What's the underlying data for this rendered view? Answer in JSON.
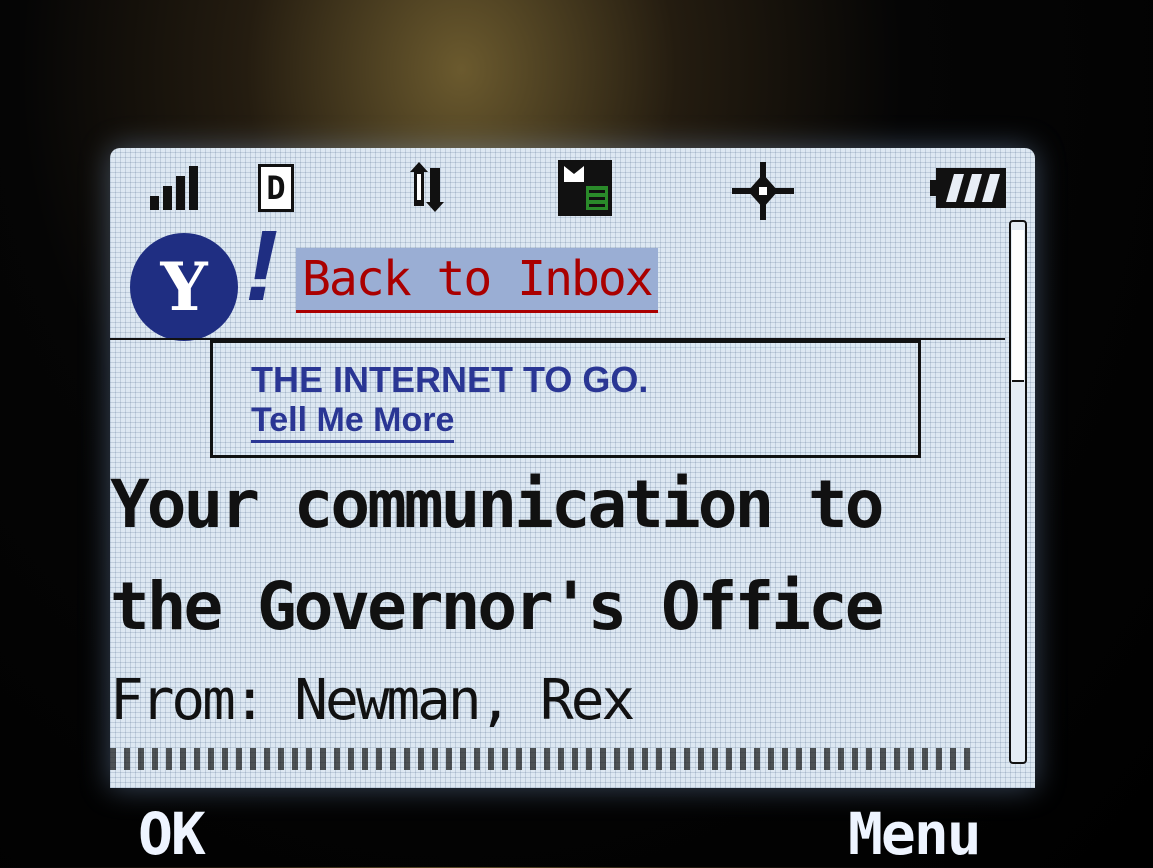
{
  "status_bar": {
    "network_label": "D",
    "icons": [
      "signal-strength-icon",
      "digital-network-icon",
      "data-transfer-icon",
      "message-icon",
      "gps-location-icon",
      "battery-icon"
    ]
  },
  "header": {
    "logo_letter": "Y",
    "logo_bang": "!",
    "back_link": "Back to Inbox"
  },
  "ad": {
    "headline": "THE INTERNET TO GO.",
    "link": "Tell Me More"
  },
  "message": {
    "subject_line1": "Your communication to",
    "subject_line2": "the Governor's Office",
    "from": "From: Newman, Rex"
  },
  "softkeys": {
    "left": "OK",
    "right": "Menu"
  },
  "colors": {
    "screen_bg": "#dde8f2",
    "link_red": "#aa0000",
    "yahoo_blue": "#1f2e82",
    "ad_blue": "#2a3694"
  }
}
